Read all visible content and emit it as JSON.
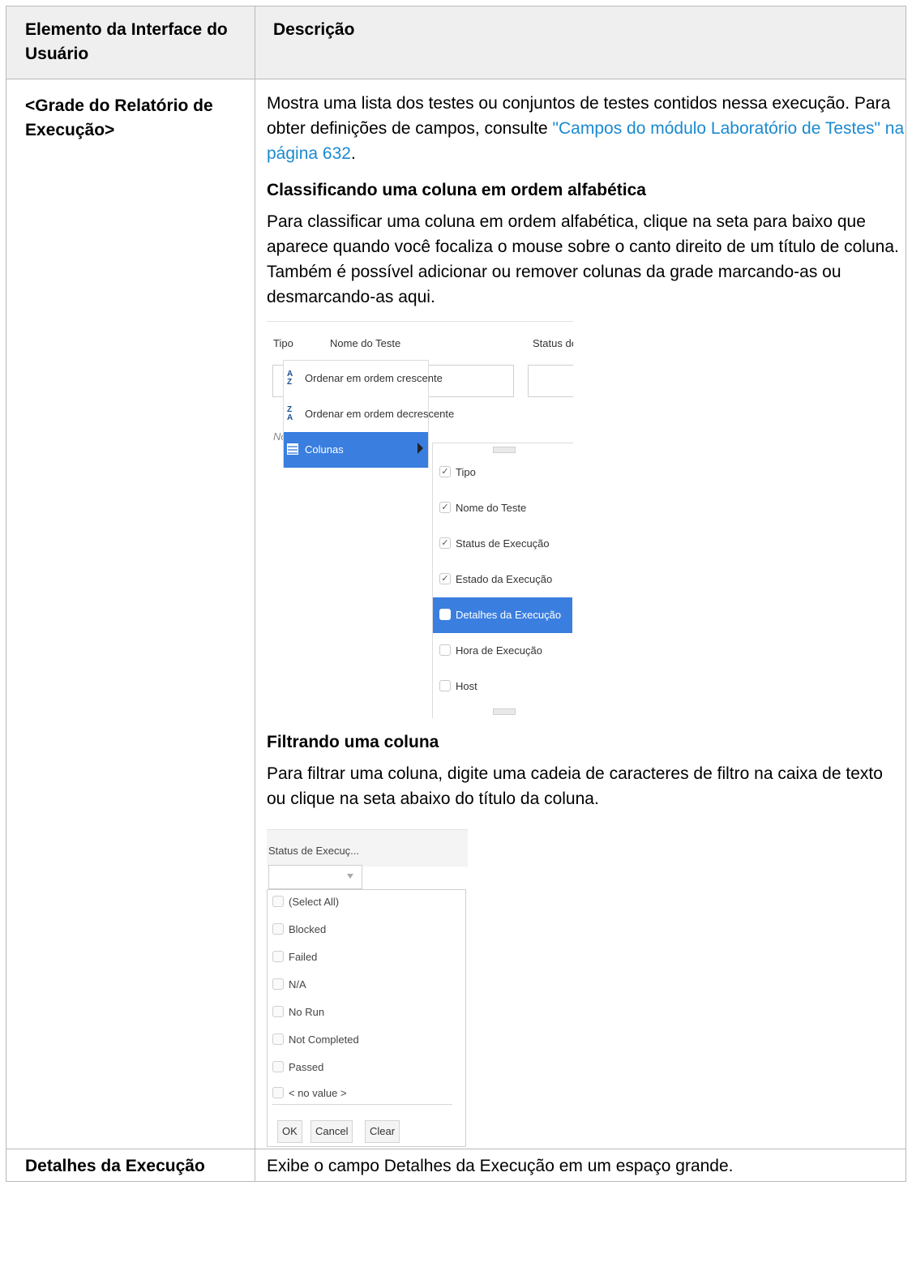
{
  "table": {
    "header": {
      "element": "Elemento da Interface do Usuário",
      "description": "Descrição"
    },
    "rows": [
      {
        "element": "<Grade do Relatório de Execução>",
        "intro_text": "Mostra uma lista dos testes ou conjuntos de testes contidos nessa execução. Para obter definições de campos, consulte ",
        "intro_link": "\"Campos do módulo Laboratório de Testes\" na página 632",
        "intro_end": ".",
        "sort_heading": "Classificando uma coluna em ordem alfabética",
        "sort_text": "Para classificar uma coluna em ordem alfabética, clique na seta para baixo que aparece quando você focaliza o mouse sobre o canto direito de um título de coluna. Também é possível adicionar ou remover colunas da grade marcando-as ou desmarcando-as aqui.",
        "filter_heading": "Filtrando uma coluna",
        "filter_text": "Para filtrar uma coluna, digite uma cadeia de caracteres de filtro na caixa de texto ou clique na seta abaixo do título da coluna."
      },
      {
        "element": "Detalhes da Execução",
        "description": "Exibe o campo Detalhes da Execução em um espaço grande."
      }
    ]
  },
  "screenshot_sort": {
    "columns": [
      "Tipo",
      "Nome do Teste",
      "Status de E"
    ],
    "no_text": "No",
    "menu": [
      {
        "label": "Ordenar em ordem crescente",
        "icon": "sort-ascending-icon"
      },
      {
        "label": "Ordenar em ordem decrescente",
        "icon": "sort-descending-icon"
      },
      {
        "label": "Colunas",
        "icon": "columns-icon",
        "selected": true
      }
    ],
    "submenu": [
      {
        "label": "Tipo",
        "checked": true
      },
      {
        "label": "Nome do Teste",
        "checked": true
      },
      {
        "label": "Status de Execução",
        "checked": true
      },
      {
        "label": "Estado da Execução",
        "checked": true
      },
      {
        "label": "Detalhes da Execução",
        "checked": false,
        "highlighted": true
      },
      {
        "label": "Hora de Execução",
        "checked": false
      },
      {
        "label": "Host",
        "checked": false
      }
    ],
    "highlight_color": "#3a7ee0"
  },
  "screenshot_filter": {
    "column_title": "Status de Execuç...",
    "options": [
      "(Select All)",
      "Blocked",
      "Failed",
      "N/A",
      "No Run",
      "Not Completed",
      "Passed",
      "< no value >"
    ],
    "buttons": {
      "ok": "OK",
      "cancel": "Cancel",
      "clear": "Clear"
    }
  },
  "colors": {
    "link": "#1a8ad0",
    "header_bg": "#efefef",
    "border": "#b9b9b9"
  }
}
